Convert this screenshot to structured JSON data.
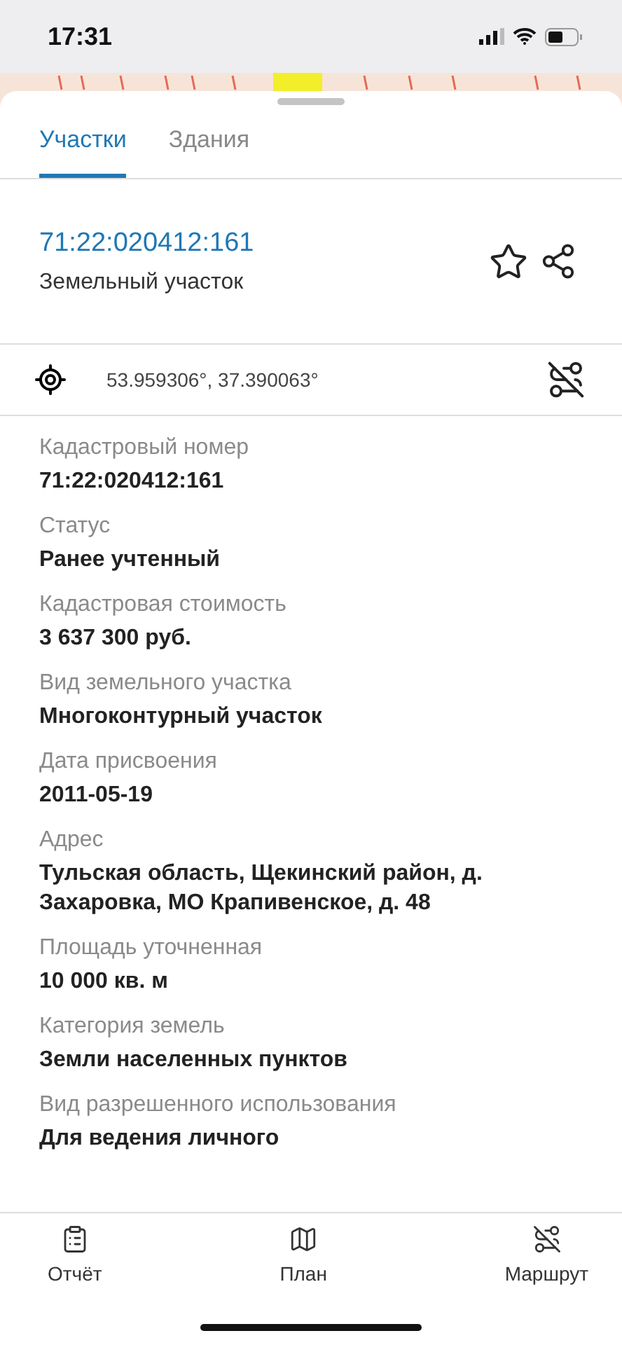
{
  "status_bar": {
    "time": "17:31"
  },
  "tabs": [
    {
      "label": "Участки",
      "selected": true
    },
    {
      "label": "Здания",
      "selected": false
    }
  ],
  "parcel": {
    "number": "71:22:020412:161",
    "type": "Земельный участок",
    "favorite": false
  },
  "coordinates": "53.959306°, 37.390063°",
  "details": [
    {
      "label": "Кадастровый номер",
      "value": "71:22:020412:161"
    },
    {
      "label": "Статус",
      "value": "Ранее учтенный"
    },
    {
      "label": "Кадастровая стоимость",
      "value": "3 637 300 руб."
    },
    {
      "label": "Вид земельного участка",
      "value": "Многоконтурный участок"
    },
    {
      "label": "Дата присвоения",
      "value": "2011-05-19"
    },
    {
      "label": "Адрес",
      "value": "Тульская область, Щекинский район, д. Захаровка, МО Крапивенское, д. 48"
    },
    {
      "label": "Площадь уточненная",
      "value": "10 000 кв. м"
    },
    {
      "label": "Категория земель",
      "value": "Земли населенных пунктов"
    },
    {
      "label": "Вид разрешенного использования",
      "value": "Для ведения личного"
    }
  ],
  "bottom_nav": [
    {
      "kind": "report",
      "label": "Отчёт"
    },
    {
      "kind": "plan",
      "label": "План"
    },
    {
      "kind": "route",
      "label": "Маршрут"
    }
  ]
}
